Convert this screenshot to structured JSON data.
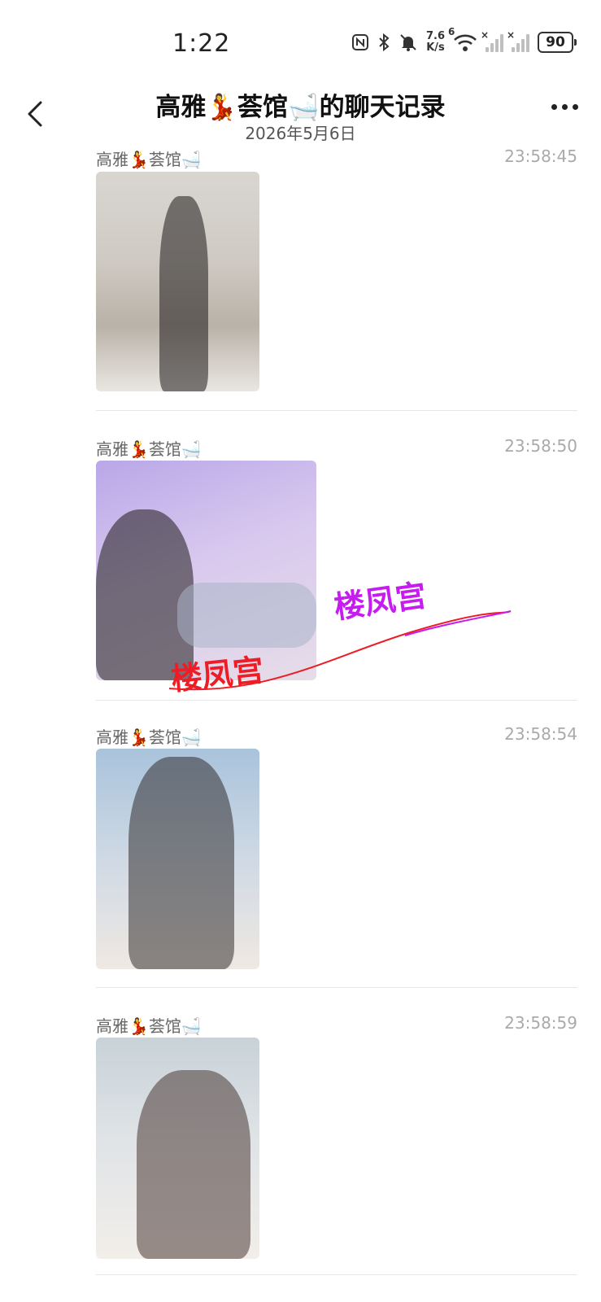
{
  "status_bar": {
    "time": "1:22",
    "net_speed_value": "7.6",
    "net_speed_unit": "K/s",
    "wifi_label": "6",
    "battery": "90"
  },
  "header": {
    "title": "高雅💃荟馆🛁的聊天记录",
    "date": "2026年5月6日"
  },
  "messages": [
    {
      "sender": "高雅💃荟馆🛁",
      "time": "23:58:45"
    },
    {
      "sender": "高雅💃荟馆🛁",
      "time": "23:58:50",
      "watermark": "楼凤宫"
    },
    {
      "sender": "高雅💃荟馆🛁",
      "time": "23:58:54"
    },
    {
      "sender": "高雅💃荟馆🛁",
      "time": "23:58:59"
    }
  ],
  "colors": {
    "watermark_red": "#ee1c25",
    "watermark_magenta": "#c61cf0"
  }
}
